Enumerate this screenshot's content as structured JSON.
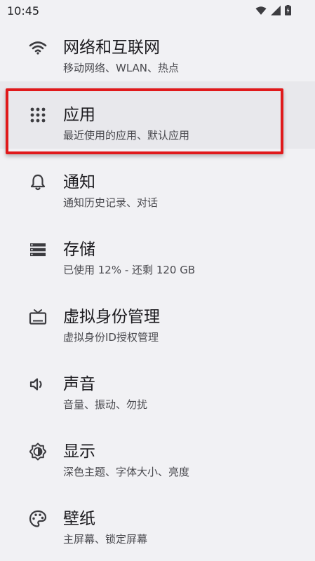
{
  "status_bar": {
    "time": "10:45",
    "icons": [
      "wifi-icon",
      "signal-icon",
      "battery-icon"
    ]
  },
  "settings": {
    "items": [
      {
        "icon": "wifi-icon",
        "title": "网络和互联网",
        "subtitle": "移动网络、WLAN、热点"
      },
      {
        "icon": "apps-grid-icon",
        "title": "应用",
        "subtitle": "最近使用的应用、默认应用"
      },
      {
        "icon": "bell-icon",
        "title": "通知",
        "subtitle": "通知历史记录、对话"
      },
      {
        "icon": "storage-icon",
        "title": "存储",
        "subtitle": "已使用 12% - 还剩 120 GB"
      },
      {
        "icon": "tv-icon",
        "title": "虚拟身份管理",
        "subtitle": "虚拟身份ID授权管理"
      },
      {
        "icon": "speaker-icon",
        "title": "声音",
        "subtitle": "音量、振动、勿扰"
      },
      {
        "icon": "brightness-icon",
        "title": "显示",
        "subtitle": "深色主题、字体大小、亮度"
      },
      {
        "icon": "palette-icon",
        "title": "壁纸",
        "subtitle": "主屏幕、锁定屏幕"
      }
    ]
  },
  "colors": {
    "background": "#f1f1f4",
    "highlight": "#e0191b",
    "text_primary": "#1c1b1f",
    "text_secondary": "#4a4a4f"
  }
}
